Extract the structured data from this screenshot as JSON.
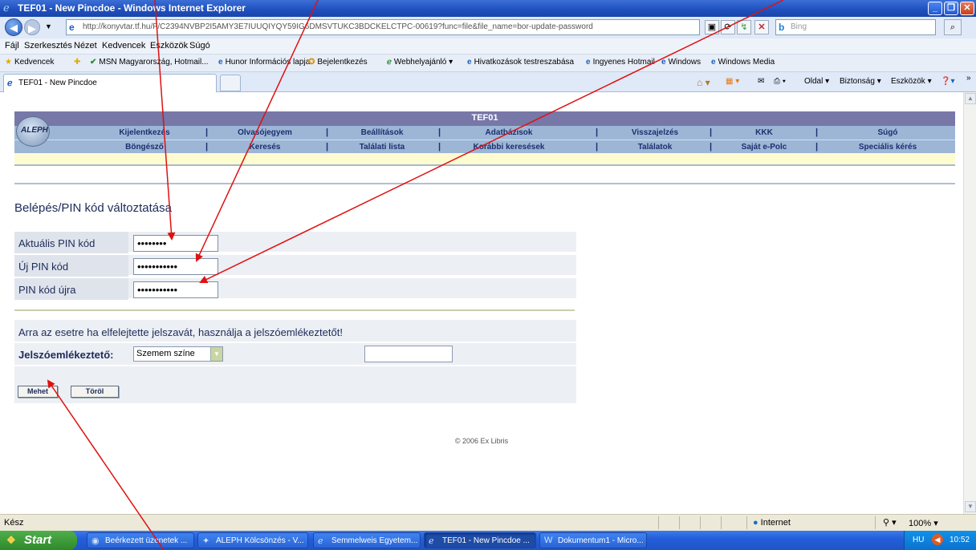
{
  "window": {
    "title": "TEF01 - New Pincdoe - Windows Internet Explorer"
  },
  "address": {
    "url": "http://konyvtar.tf.hu/F/C2394NVBP2I5AMY3E7IUUQIYQY59IG6DMSVTUKC3BDCKELCTPC-00619?func=file&file_name=bor-update-password",
    "search_placeholder": "Bing"
  },
  "menubar": [
    "Fájl",
    "Szerkesztés",
    "Nézet",
    "Kedvencek",
    "Eszközök",
    "Súgó"
  ],
  "favorites": {
    "label": "Kedvencek",
    "items": [
      "MSN Magyarország, Hotmail...",
      "Hunor Információs lapja",
      "Bejelentkezés",
      "Webhelyajánló ▾",
      "Hivatkozások testreszabása",
      "Ingyenes Hotmail",
      "Windows",
      "Windows Media"
    ]
  },
  "tab": {
    "label": "TEF01 - New Pincdoe"
  },
  "commandbar": {
    "page": "Oldal ▾",
    "safety": "Biztonság ▾",
    "tools": "Eszközök ▾"
  },
  "aleph": {
    "logo": "ALEPH",
    "title": "TEF01",
    "nav_row1": [
      "Kijelentkezés",
      "Olvasójegyem",
      "Beállítások",
      "Adatbázisok",
      "Visszajelzés",
      "KKK",
      "Súgó"
    ],
    "nav_row2": [
      "Böngésző",
      "Keresés",
      "Találati lista",
      "Korábbi keresések",
      "Találatok",
      "Saját e-Polc",
      "Speciális kérés"
    ]
  },
  "form": {
    "title": "Belépés/PIN kód változtatása",
    "current_pin_label": "Aktuális PIN kód",
    "current_pin_mask": "••••••••",
    "new_pin_label": "Új PIN kód",
    "new_pin_mask": "•••••••••••",
    "repeat_pin_label": "PIN kód újra",
    "repeat_pin_mask": "•••••••••••",
    "hint_text": "Arra az esetre ha elfelejtette jelszavát, használja a jelszóemlékeztetőt!",
    "reminder_label": "Jelszóemlékeztető:",
    "reminder_selected": "Szemem színe",
    "submit_label": "Mehet",
    "clear_label": "Töröl"
  },
  "copyright": "© 2006 Ex Libris",
  "status": {
    "text": "Kész",
    "zone": "Internet",
    "zoom": "100%"
  },
  "taskbar": {
    "start": "Start",
    "tasks": [
      "Beérkezett üzenetek ...",
      "ALEPH Kölcsönzés - V...",
      "Semmelweis Egyetem...",
      "TEF01 - New Pincdoe ...",
      "Dokumentum1 - Micro..."
    ],
    "lang": "HU",
    "clock": "10:52"
  }
}
